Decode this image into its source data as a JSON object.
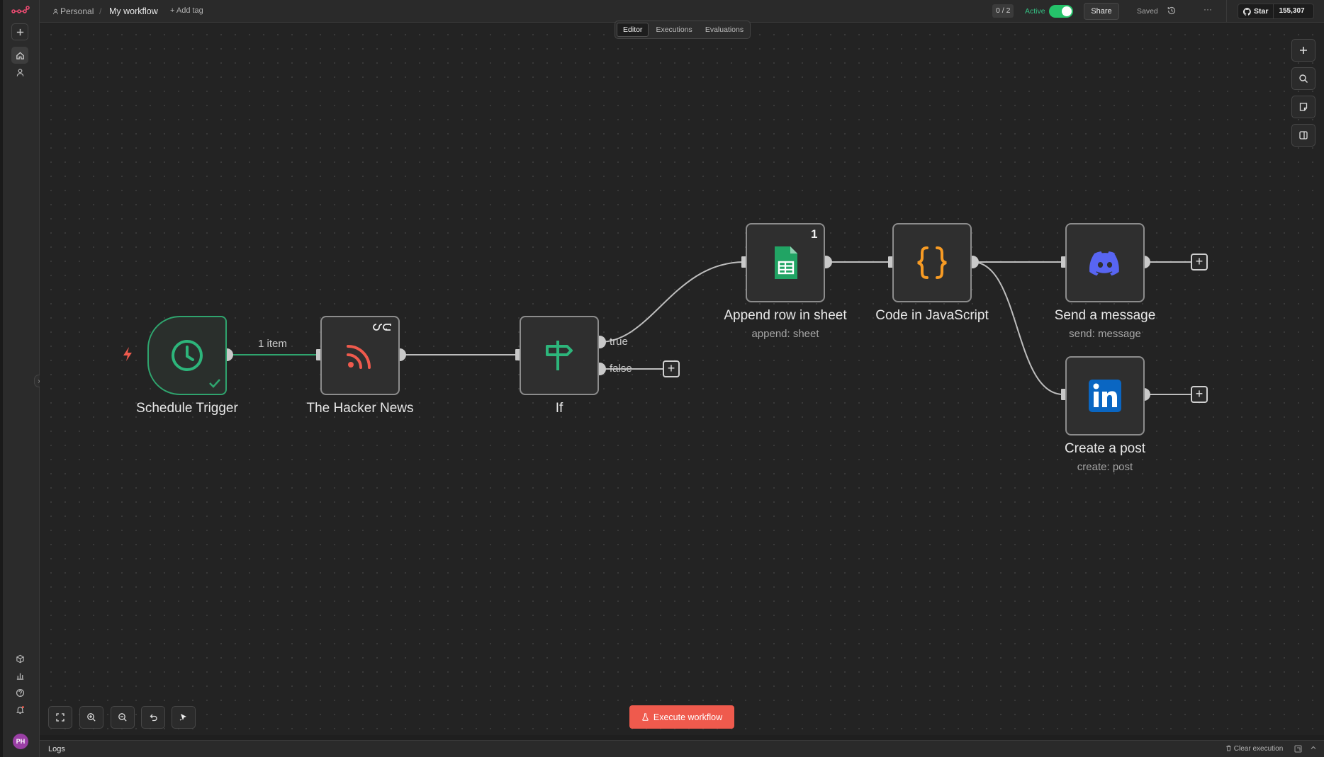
{
  "header": {
    "project": "Personal",
    "workflow_name": "My workflow",
    "add_tag": "+ Add tag",
    "run_count": "0 / 2",
    "active_label": "Active",
    "active": true,
    "share_label": "Share",
    "saved_label": "Saved",
    "github_star_label": "Star",
    "github_star_count": "155,307"
  },
  "tabs": [
    {
      "label": "Editor",
      "active": true
    },
    {
      "label": "Executions",
      "active": false
    },
    {
      "label": "Evaluations",
      "active": false
    }
  ],
  "nodes": {
    "schedule_trigger": {
      "label": "Schedule Trigger",
      "icon": "clock-icon",
      "status": "success"
    },
    "hacker_news": {
      "label": "The Hacker News",
      "icon": "rss-icon"
    },
    "if": {
      "label": "If",
      "icon": "signpost-icon",
      "outputs": [
        "true",
        "false"
      ]
    },
    "append_row": {
      "label": "Append row in sheet",
      "subtitle": "append: sheet",
      "icon": "google-sheets-icon",
      "run_count": "1"
    },
    "code_js": {
      "label": "Code in JavaScript",
      "icon": "code-braces-icon"
    },
    "send_message": {
      "label": "Send a message",
      "subtitle": "send: message",
      "icon": "discord-icon"
    },
    "create_post": {
      "label": "Create a post",
      "subtitle": "create: post",
      "icon": "linkedin-icon"
    }
  },
  "edges": {
    "trigger_to_hn_label": "1 item"
  },
  "execute_label": "Execute workflow",
  "logs": {
    "label": "Logs",
    "clear_label": "Clear execution"
  },
  "colors": {
    "accent": "#ef5a4d",
    "success": "#2fa46e",
    "canvas": "#232323"
  }
}
